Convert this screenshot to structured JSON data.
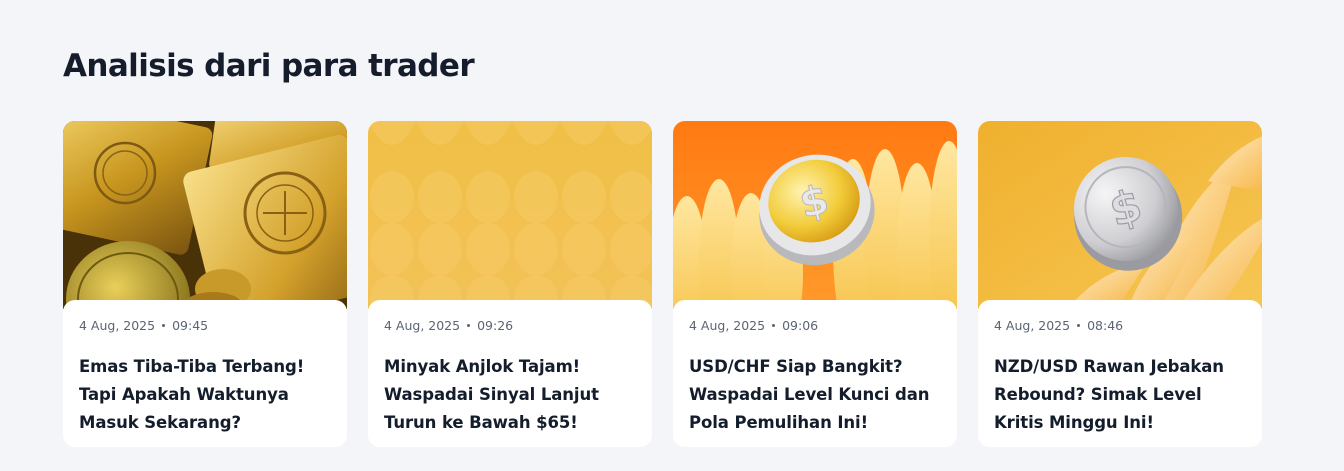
{
  "section": {
    "title": "Analisis dari para trader"
  },
  "cards": [
    {
      "date": "4 Aug, 2025",
      "time": "09:45",
      "title": "Emas Tiba-Tiba Terbang! Tapi Apakah Waktunya Masuk Sekarang?",
      "image": "gold-bars-image"
    },
    {
      "date": "4 Aug, 2025",
      "time": "09:26",
      "title": "Minyak Anjlok Tajam! Waspadai Sinyal Lanjut Turun ke Bawah $65!",
      "image": "yellow-pattern-image"
    },
    {
      "date": "4 Aug, 2025",
      "time": "09:06",
      "title": "USD/CHF Siap Bangkit? Waspadai Level Kunci dan Pola Pemulihan Ini!",
      "image": "gold-coin-orange-image"
    },
    {
      "date": "4 Aug, 2025",
      "time": "08:46",
      "title": "NZD/USD Rawan Jebakan Rebound? Simak Level Kritis Minggu Ini!",
      "image": "silver-coin-yellow-image"
    }
  ],
  "colors": {
    "background": "#f4f5f9",
    "card": "#ffffff",
    "text": "#141d2b",
    "meta": "#5b6474"
  }
}
